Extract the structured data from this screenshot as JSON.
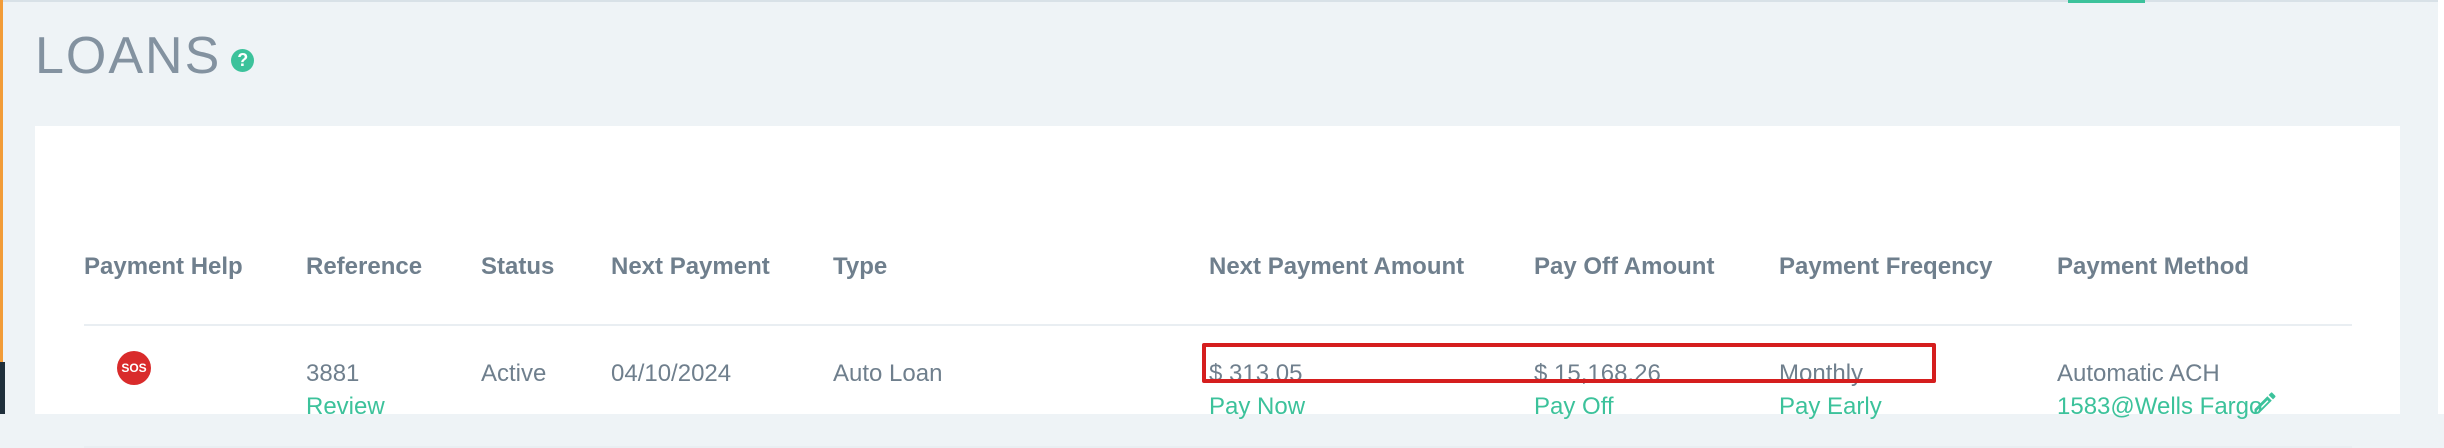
{
  "page": {
    "title": "LOANS"
  },
  "help": {
    "icon": "?"
  },
  "table": {
    "columns": [
      "Payment Help",
      "Reference",
      "Status",
      "Next Payment",
      "Type",
      "Next Payment Amount",
      "Pay Off Amount",
      "Payment Freqency",
      "Payment Method"
    ],
    "rows": [
      {
        "sos": "SOS",
        "reference": "3881",
        "review": "Review",
        "status": "Active",
        "next_payment": "04/10/2024",
        "type": "Auto Loan",
        "next_payment_amount": "$ 313.05",
        "pay_now": "Pay Now",
        "pay_off_amount": "$ 15,168.26",
        "pay_off": "Pay Off",
        "payment_frequency": "Monthly",
        "pay_early": "Pay Early",
        "payment_method": "Automatic ACH",
        "payment_method_account": "1583@Wells Fargo"
      }
    ]
  },
  "colors": {
    "accent": "#3cc29b",
    "highlight": "#d51e1e",
    "text": "#6f7f8d"
  },
  "icons": {
    "help": "question-circle-icon",
    "sos": "sos-icon",
    "edit": "pencil-icon"
  }
}
